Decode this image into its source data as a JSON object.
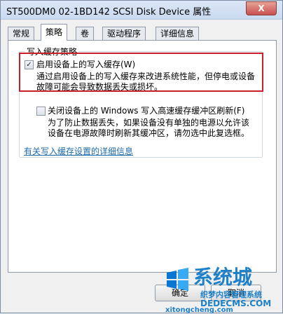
{
  "window": {
    "title": "ST500DM0 02-1BD142 SCSI Disk Device 属性",
    "close_label": "X"
  },
  "tabs": [
    {
      "label": "常规",
      "active": false
    },
    {
      "label": "策略",
      "active": true
    },
    {
      "label": "卷",
      "active": false
    },
    {
      "label": "驱动程序",
      "active": false
    },
    {
      "label": "详细信息",
      "active": false
    }
  ],
  "policy": {
    "group_title": "写入缓存策略",
    "option1": {
      "checked": true,
      "label": "启用设备上的写入缓存(W)",
      "description_line1": "通过启用设备上的写入缓存来改进系统性能，但停电或设备",
      "description_line2": "故障可能会导致数据丢失或损坏。"
    },
    "option2": {
      "checked": false,
      "label": "关闭设备上的 Windows 写入高速缓存缓冲区刷新(F)",
      "description_line1": "为了防止数据丢失，如果设备没有单独的电源以允许该",
      "description_line2": "设备在电源故障时刷新其缓冲区，请勿选中此复选框。"
    },
    "details_link": "有关写入缓存设置的详细信息"
  },
  "buttons": {
    "ok": "确定",
    "cancel": "取消"
  },
  "watermark": {
    "brand": "系统城",
    "sub1": "织梦内容管理系统",
    "sub2": "DEDECMS.COM",
    "url": "xitongcheng.com"
  }
}
